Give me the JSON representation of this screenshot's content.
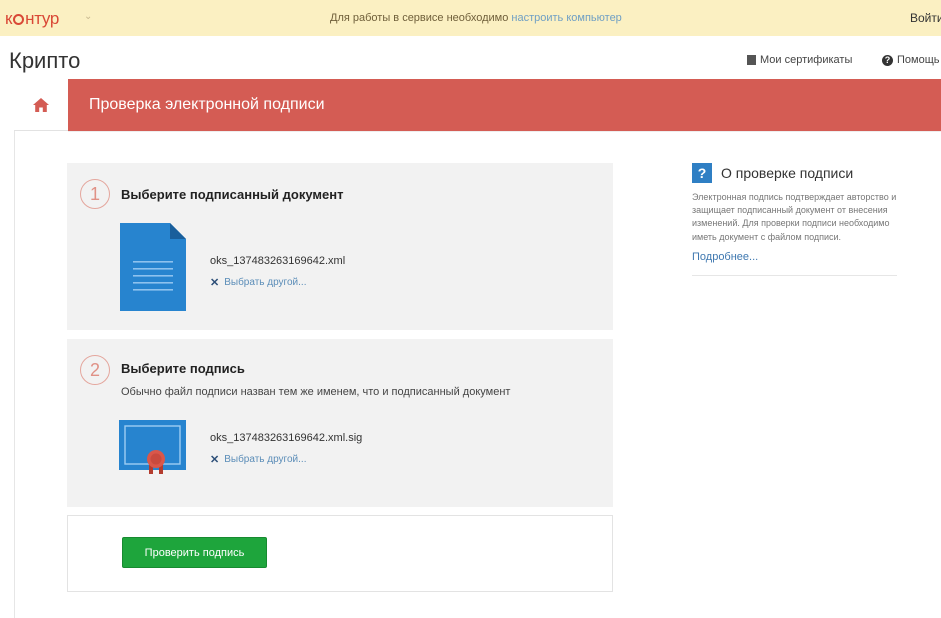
{
  "topbar": {
    "logo_pre": "к",
    "logo_post": "нтур",
    "logo_caret": "⌄",
    "notice_text": "Для работы в сервисе необходимо",
    "notice_link": "настроить компьютер",
    "login": "Войти"
  },
  "header": {
    "app_title": "Крипто",
    "certificates": "Мои сертификаты",
    "help": "Помощь"
  },
  "page": {
    "title": "Проверка электронной подписи"
  },
  "step1": {
    "number": "1",
    "title": "Выберите подписанный документ",
    "file_name": "oks_137483263169642.xml",
    "choose_other": "Выбрать другой..."
  },
  "step2": {
    "number": "2",
    "title": "Выберите подпись",
    "subtitle": "Обычно файл подписи назван тем же именем, что и подписанный документ",
    "file_name": "oks_137483263169642.xml.sig",
    "choose_other": "Выбрать другой..."
  },
  "actions": {
    "verify_button": "Проверить подпись"
  },
  "sidebar": {
    "icon_glyph": "?",
    "title": "О проверке подписи",
    "text": "Электронная подпись подтверждает авторство и защищает подписанный документ от внесения изменений. Для проверки подписи необходимо иметь документ с файлом подписи.",
    "more_link": "Подробнее..."
  },
  "colors": {
    "brand": "#d94836",
    "title_bar": "#d45c54",
    "notice_bg": "#fbf0c2",
    "accent_blue": "#2f7fc4",
    "button_green": "#1ea53c"
  },
  "icons": {
    "home": "home-icon",
    "certificates": "certificate-icon",
    "help": "help-circle-icon",
    "document": "document-icon",
    "signature": "signature-certificate-icon",
    "remove": "close-icon",
    "info": "question-icon"
  }
}
